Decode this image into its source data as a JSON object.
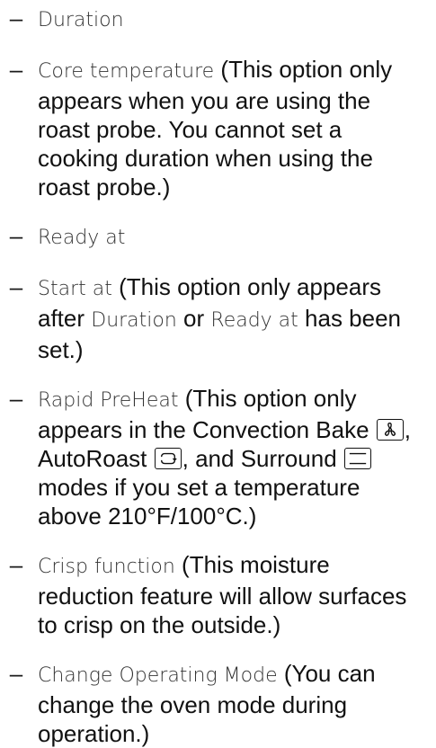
{
  "bullet": "–",
  "items": [
    {
      "label": "Duration"
    },
    {
      "label": "Core temperature",
      "note": " (This option only appears when you are using the roast probe. You cannot set a cooking duration when using the roast probe.)"
    },
    {
      "label": "Ready at"
    },
    {
      "label": "Start at",
      "note_a": " (This option only appears after ",
      "ref1": "Duration",
      "note_b": " or ",
      "ref2": "Ready at",
      "note_c": " has been set.)"
    },
    {
      "label": "Rapid PreHeat",
      "note_a": " (This option only appears in the Convection Bake ",
      "icon1": "convection-fan-icon",
      "note_b": ", AutoRoast ",
      "icon2": "autoroast-icon",
      "note_c": ", and Surround ",
      "icon3": "surround-heat-icon",
      "note_d": " modes if you set a temperature above 210°F/100°C.)"
    },
    {
      "label": "Crisp function",
      "note": " (This moisture reduction feature will allow surfaces to crisp on the outside.)"
    },
    {
      "label": "Change Operating Mode",
      "note": " (You can change the oven mode during operation.)"
    }
  ]
}
